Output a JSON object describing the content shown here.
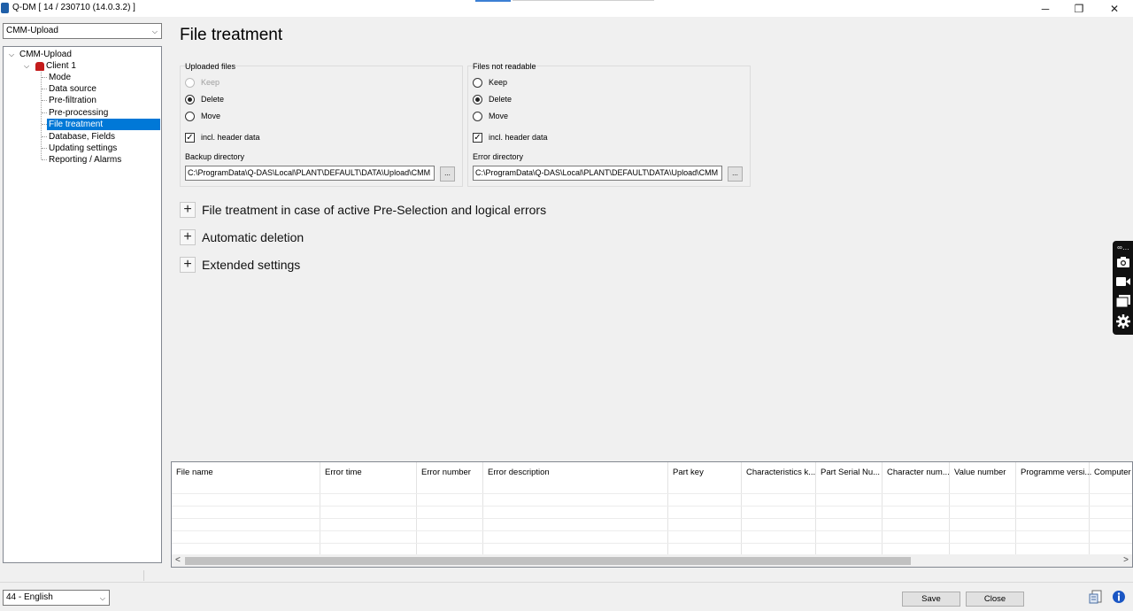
{
  "window": {
    "title": "Q-DM [ 14 / 230710 (14.0.3.2) ]",
    "minimize": "─",
    "restore": "❐",
    "close": "✕"
  },
  "sidebar": {
    "module_select": "CMM-Upload",
    "tree": {
      "root": "CMM-Upload",
      "client": "Client 1",
      "items": [
        "Mode",
        "Data source",
        "Pre-filtration",
        "Pre-processing",
        "File treatment",
        "Database, Fields",
        "Updating settings",
        "Reporting / Alarms"
      ],
      "selected": "File treatment"
    }
  },
  "main": {
    "title": "File treatment",
    "uploaded": {
      "label": "Uploaded files",
      "options": [
        "Keep",
        "Delete",
        "Move"
      ],
      "selected": "Delete",
      "disabled": "Keep",
      "header_label": "incl. header data",
      "header_checked": true,
      "dir_label": "Backup directory",
      "dir_value": "C:\\ProgramData\\Q-DAS\\Local\\PLANT\\DEFAULT\\DATA\\Upload\\CMM",
      "browse": "..."
    },
    "unreadable": {
      "label": "Files not readable",
      "options": [
        "Keep",
        "Delete",
        "Move"
      ],
      "selected": "Delete",
      "header_label": "incl. header data",
      "header_checked": true,
      "dir_label": "Error directory",
      "dir_value": "C:\\ProgramData\\Q-DAS\\Local\\PLANT\\DEFAULT\\DATA\\Upload\\CMM",
      "browse": "..."
    },
    "expanders": [
      "File treatment in case of active Pre-Selection and logical errors",
      "Automatic deletion",
      "Extended settings"
    ],
    "expander_symbol": "+"
  },
  "grid": {
    "columns": [
      "File name",
      "Error time",
      "Error number",
      "Error description",
      "Part key",
      "Characteristics k...",
      "Part Serial Nu...",
      "Character num...",
      "Value number",
      "Programme versi...",
      "Computer"
    ],
    "scroll_left": "<",
    "scroll_right": ">"
  },
  "footer": {
    "language": "44 - English",
    "save": "Save",
    "close": "Close"
  },
  "colors": {
    "selection": "#0078d7",
    "background": "#f0f0f0"
  }
}
